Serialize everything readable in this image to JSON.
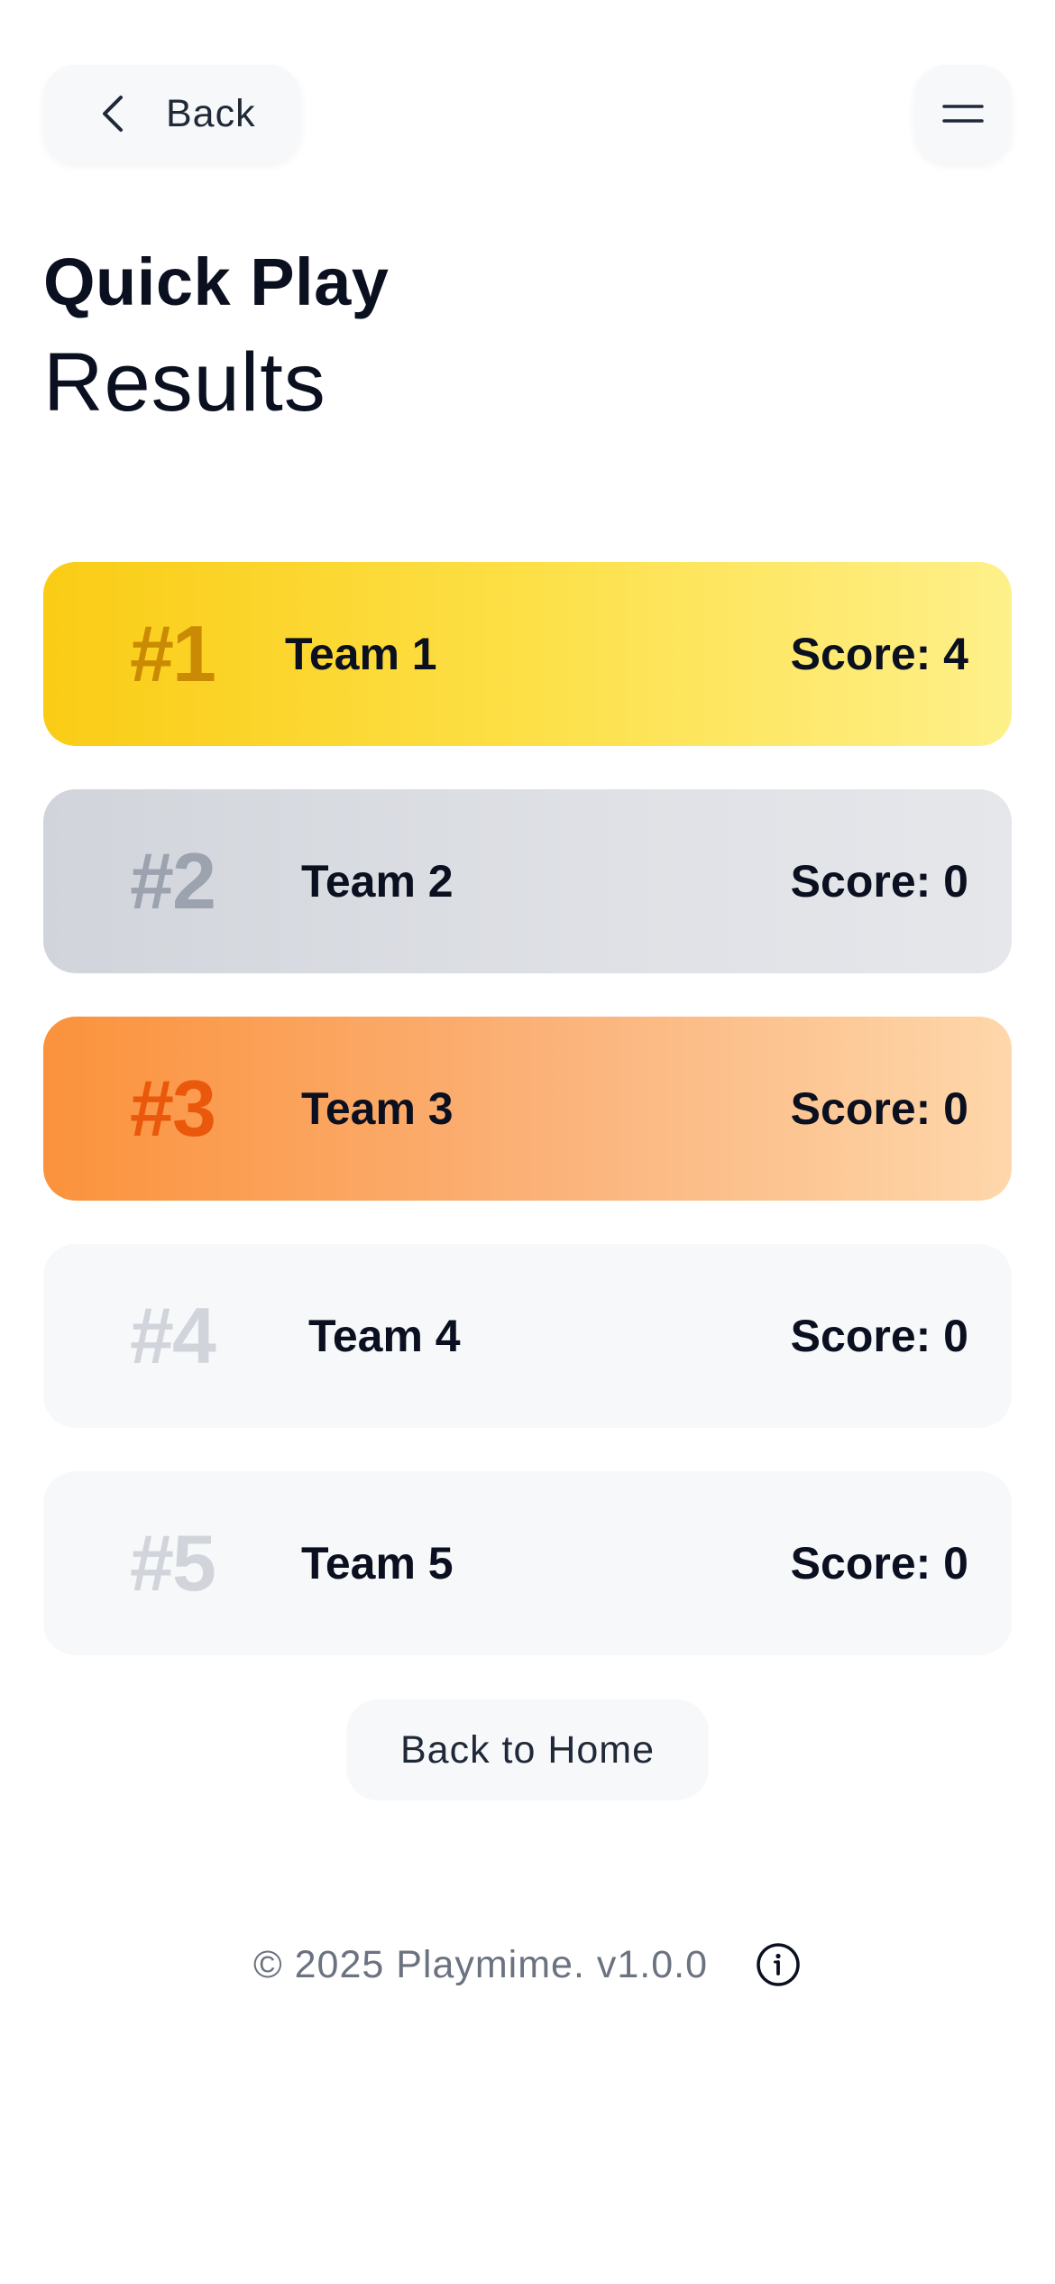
{
  "header": {
    "back_label": "Back",
    "back_icon": "chevron-left-icon",
    "menu_icon": "menu-icon"
  },
  "title": {
    "line1": "Quick Play",
    "line2": "Results"
  },
  "results": [
    {
      "rank": "#1",
      "team": "Team 1",
      "score": "Score: 4"
    },
    {
      "rank": "#2",
      "team": "Team 2",
      "score": "Score: 0"
    },
    {
      "rank": "#3",
      "team": "Team 3",
      "score": "Score: 0"
    },
    {
      "rank": "#4",
      "team": "Team 4",
      "score": "Score: 0"
    },
    {
      "rank": "#5",
      "team": "Team 5",
      "score": "Score: 0"
    }
  ],
  "home_button_label": "Back to Home",
  "footer": {
    "text": "© 2025 Playmime. v1.0.0",
    "info_icon": "info-icon"
  },
  "colors": {
    "gold": "#facc15",
    "silver": "#d1d5db",
    "bronze": "#fb923c",
    "neutral_card": "#f7f8fa",
    "text": "#0b1020"
  }
}
